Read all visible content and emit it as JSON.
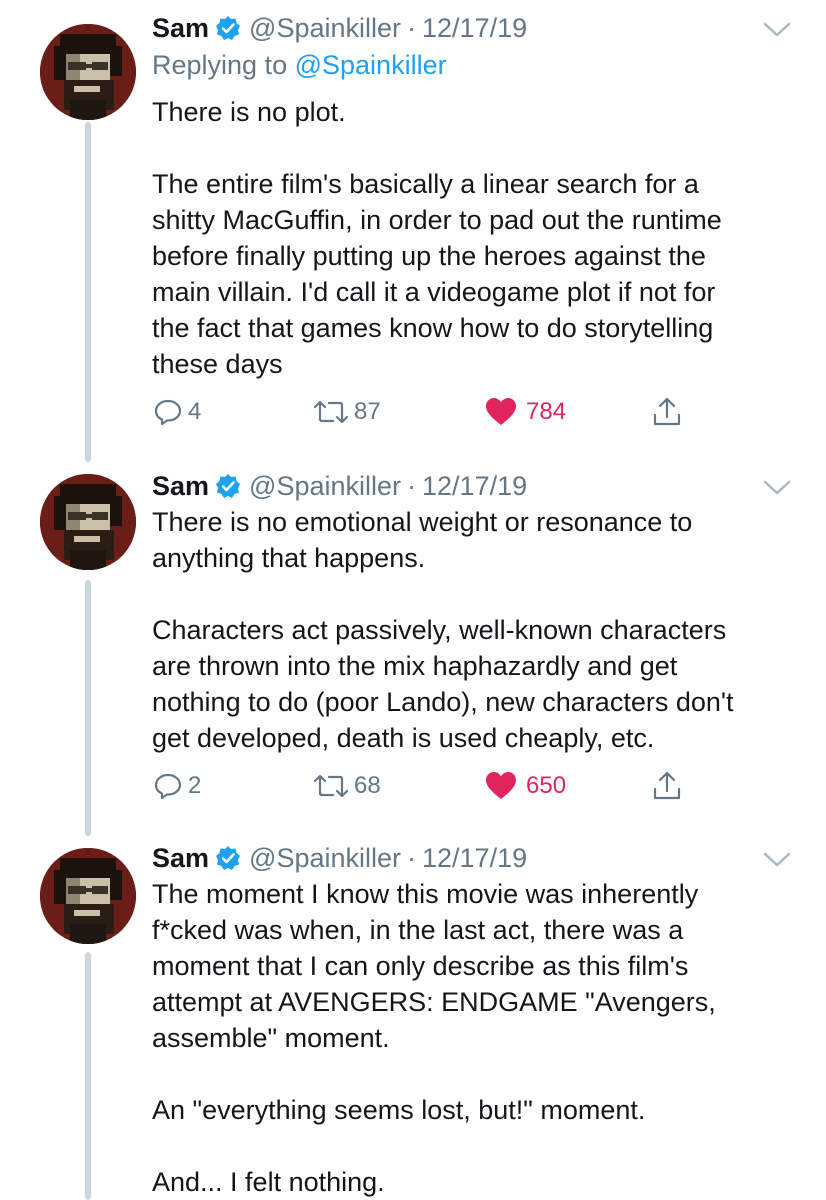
{
  "colors": {
    "text": "#14171a",
    "muted": "#657786",
    "accent_blue": "#1da1f2",
    "like_red": "#e0245e",
    "thread_line": "#ccd6dd"
  },
  "tweets": [
    {
      "author": {
        "name": "Sam",
        "verified": true,
        "handle": "@Spainkiller",
        "separator": "·",
        "date": "12/17/19",
        "avatar_icon": "pixel-art-bearded-man-avatar"
      },
      "reply_to": {
        "prefix": "Replying to",
        "mention": "@Spainkiller"
      },
      "paragraphs": [
        "There is no plot.",
        "The entire film's basically a linear search for a\nshitty MacGuffin, in order to pad out the runtime\nbefore finally putting up the heroes against the\nmain villain. I'd call it a videogame plot if not for\nthe fact that games know how to do storytelling\nthese days"
      ],
      "stats": {
        "replies": "4",
        "retweets": "87",
        "likes": "784",
        "liked": true
      }
    },
    {
      "author": {
        "name": "Sam",
        "verified": true,
        "handle": "@Spainkiller",
        "separator": "·",
        "date": "12/17/19",
        "avatar_icon": "pixel-art-bearded-man-avatar"
      },
      "paragraphs": [
        "There is no emotional weight or resonance to\nanything that happens.",
        "Characters act passively, well-known characters\nare thrown into the mix haphazardly and get\nnothing to do (poor Lando), new characters don't\nget developed, death is used cheaply, etc."
      ],
      "stats": {
        "replies": "2",
        "retweets": "68",
        "likes": "650",
        "liked": true
      }
    },
    {
      "author": {
        "name": "Sam",
        "verified": true,
        "handle": "@Spainkiller",
        "separator": "·",
        "date": "12/17/19",
        "avatar_icon": "pixel-art-bearded-man-avatar"
      },
      "paragraphs": [
        "The moment I know this movie was inherently\nf*cked was when, in the last act, there was a\nmoment that I can only describe as this film's\nattempt at AVENGERS: ENDGAME \"Avengers,\nassemble\" moment.",
        "An \"everything seems lost, but!\" moment.",
        "And... I felt nothing."
      ]
    }
  ],
  "icons": {
    "verified": "verified-badge-icon",
    "menu": "chevron-down-icon",
    "reply": "reply-icon",
    "retweet": "retweet-icon",
    "like": "heart-icon",
    "share": "share-icon"
  }
}
